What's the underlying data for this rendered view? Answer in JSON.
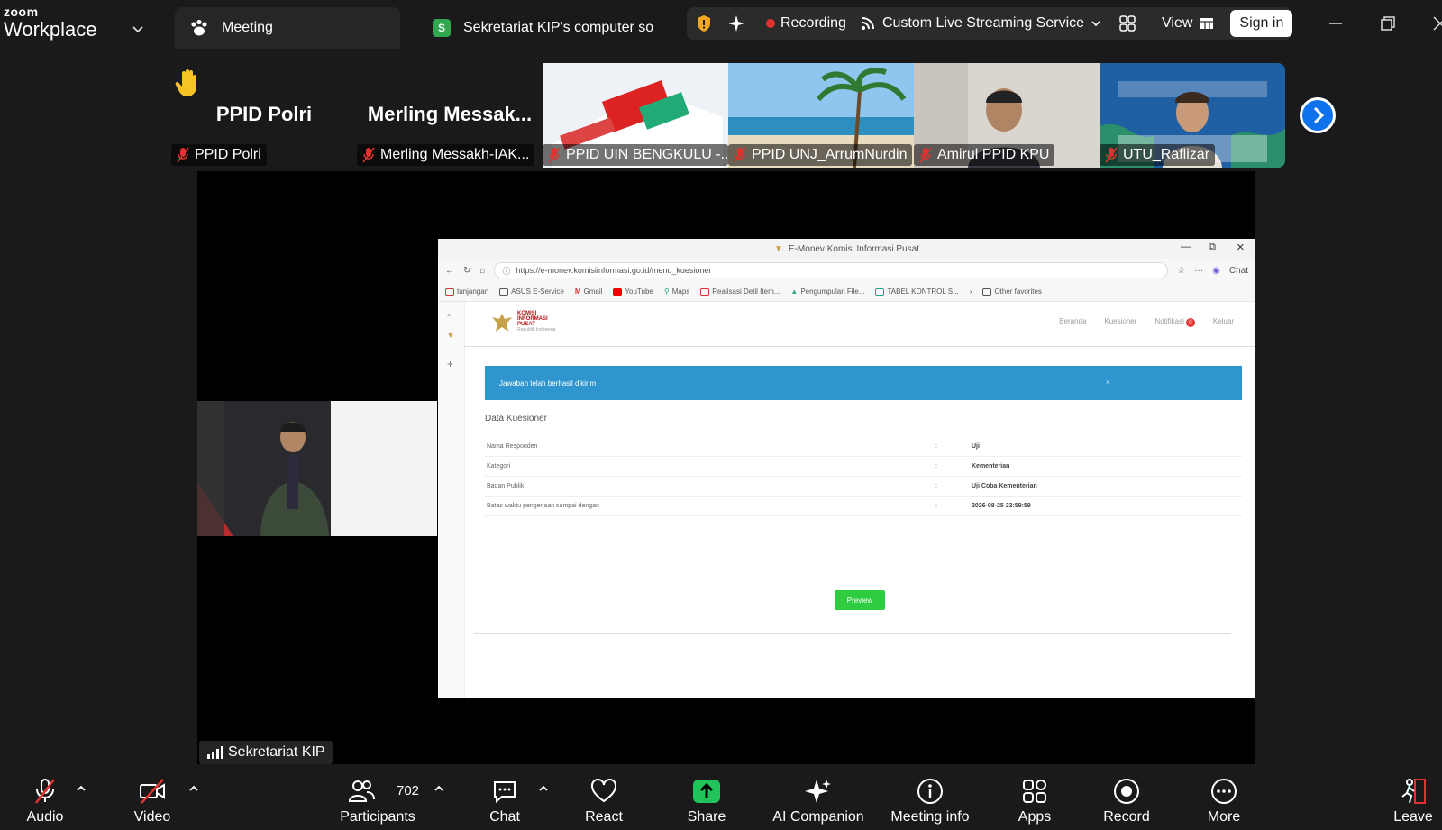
{
  "titlebar": {
    "brand_top": "zoom",
    "brand_bottom": "Workplace",
    "tab_meeting": "Meeting",
    "tab_share_badge": "S",
    "tab_share": "Sekretariat KIP's computer so",
    "recording": "Recording",
    "streaming": "Custom Live Streaming Service",
    "view": "View",
    "signin": "Sign in"
  },
  "participants_strip": [
    {
      "name_large": "PPID Polri",
      "label": "PPID Polri"
    },
    {
      "name_large": "Merling  Messak...",
      "label": "Merling Messakh-IAK..."
    },
    {
      "label": "PPID UIN BENGKULU -..."
    },
    {
      "label": "PPID UNJ_ArrumNurdin"
    },
    {
      "label": "Amirul PPID KPU"
    },
    {
      "label": "UTU_Raflizar"
    }
  ],
  "stage": {
    "active_speaker_label": "Sekretariat KIP"
  },
  "browser": {
    "window_title": "E-Monev Komisi Informasi Pusat",
    "url": "https://e-monev.komisiinformasi.go.id/menu_kuesioner",
    "chat": "Chat",
    "bookmarks": [
      "tunjangan",
      "ASUS E-Service",
      "Gmail",
      "YouTube",
      "Maps",
      "Realisasi Detil Item...",
      "Pengumpulan File...",
      "TABEL KONTROL S..."
    ],
    "other_favorites": "Other favorites",
    "site_logo_line1": "KOMISI INFORMASI PUSAT",
    "site_logo_line2": "Republik Indonesia",
    "nav": [
      "Beranda",
      "Kuesioner",
      "Notifikasi",
      "Keluar"
    ],
    "notif_count": "0",
    "alert": "Jawaban telah berhasil dikirim",
    "alert_close": "×",
    "section_title": "Data Kuesioner",
    "rows": [
      {
        "label": "Nama Responden",
        "value": "Uji"
      },
      {
        "label": "Kategori",
        "value": "Kementerian"
      },
      {
        "label": "Badan Publik",
        "value": "Uji Coba Kementerian"
      },
      {
        "label": "Batas waktu pengerjaan sampai dengan",
        "value": "2026-08-25 23:59:59"
      }
    ],
    "preview_button": "Preview"
  },
  "toolbar": {
    "audio": "Audio",
    "video": "Video",
    "participants": "Participants",
    "participants_count": "702",
    "chat": "Chat",
    "react": "React",
    "share": "Share",
    "ai_companion": "AI Companion",
    "meeting_info": "Meeting info",
    "apps": "Apps",
    "record": "Record",
    "more": "More",
    "leave": "Leave"
  },
  "colors": {
    "background": "#1a1a1a",
    "share_green": "#23c35b",
    "recording_red": "#e0332f",
    "alert_blue": "#2f95cf",
    "preview_green": "#2ecc40",
    "next_button_blue": "#0e72ed"
  }
}
